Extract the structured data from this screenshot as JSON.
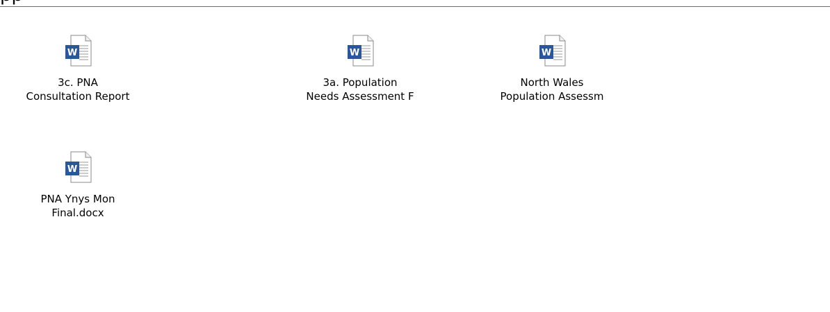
{
  "window": {
    "title_fragment": "pp"
  },
  "files": [
    {
      "icon": "word-document-icon",
      "name_line1": "3c. PNA",
      "name_line2": "Consultation Report"
    },
    {
      "icon": "word-document-icon",
      "name_line1": "3a. Population",
      "name_line2": "Needs Assessment F"
    },
    {
      "icon": "word-document-icon",
      "name_line1": "North Wales",
      "name_line2": "Population Assessm"
    },
    {
      "icon": "word-document-icon",
      "name_line1": "PNA Ynys Mon",
      "name_line2": "Final.docx"
    }
  ],
  "colors": {
    "word_blue": "#2b579a",
    "page_border": "#8a8a8a",
    "divider": "#6b6b6b"
  }
}
